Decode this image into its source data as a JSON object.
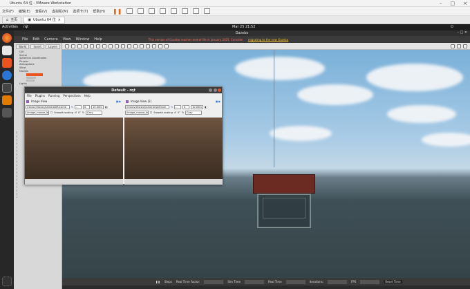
{
  "vm": {
    "title": "Ubuntu 64 位 - VMware Workstation",
    "menu": [
      "文件(F)",
      "编辑(E)",
      "查看(V)",
      "虚拟机(M)",
      "选项卡(T)",
      "帮助(H)"
    ],
    "tabs": [
      {
        "label": "主页"
      },
      {
        "label": "Ubuntu 64 位"
      }
    ]
  },
  "ubuntu": {
    "activities": "Activities",
    "app": "rqt",
    "clock": "Mar 25  21:52"
  },
  "gazebo": {
    "title": "Gazebo",
    "menu": [
      "File",
      "Edit",
      "Camera",
      "View",
      "Window",
      "Help"
    ],
    "banner": "This version of Gazebo reaches end-of-life in January 2025. Consider",
    "banner_link": "migrating to the new Gazebo",
    "left_tabs": [
      "World",
      "Insert",
      "Layers"
    ],
    "tree": [
      "GUI",
      "Scene",
      "Spherical Coordinates",
      "Physics",
      "Atmosphere",
      "Wind",
      "Models",
      "Lights"
    ],
    "bottom": {
      "steps": "Steps",
      "rtf": "Real Time Factor:",
      "sim": "Sim Time",
      "real": "Real Time",
      "iter": "Iterations:",
      "fps": "FPS",
      "reset": "Reset Time"
    }
  },
  "rqt": {
    "title": "Default - rqt",
    "menu": [
      "File",
      "Plugins",
      "Running",
      "Perspectives",
      "Help"
    ],
    "panes": [
      {
        "title": "Image View",
        "topic": "/rexrov/rexrov/cameraleft/came",
        "zoom": "10.00m",
        "mouse": "/image_mouse_left",
        "smooth": "Smooth scaling",
        "rot": "0°",
        "color": "Gray"
      },
      {
        "title": "Image View (2)",
        "topic": "/rexrov/rexrov/cameraright/cam",
        "zoom": "10.00m",
        "mouse": "/image_mouse_left",
        "smooth": "Smooth scaling",
        "rot": "0°",
        "color": "Gray"
      }
    ]
  },
  "colors": {
    "accent_red": "#e95420",
    "dock": "#272727"
  }
}
